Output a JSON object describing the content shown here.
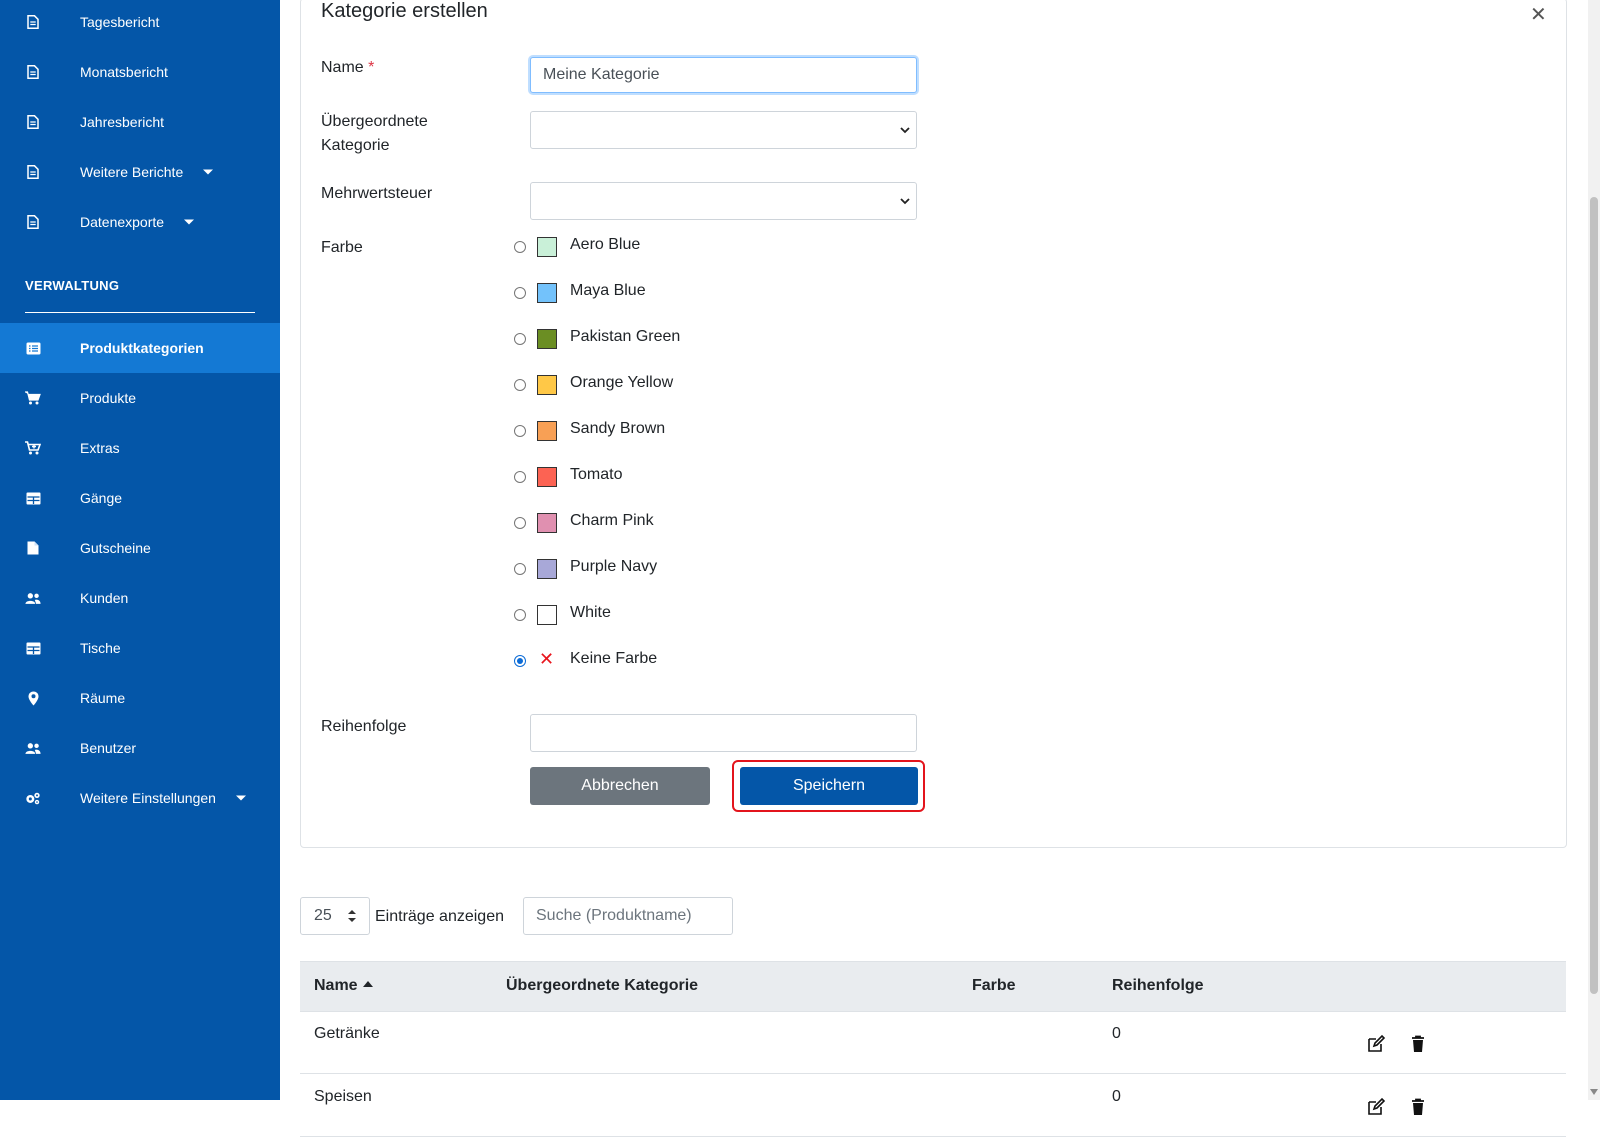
{
  "sidebar": {
    "reports": [
      {
        "label": "Tagesbericht",
        "icon": "document-icon"
      },
      {
        "label": "Monatsbericht",
        "icon": "document-icon"
      },
      {
        "label": "Jahresbericht",
        "icon": "document-icon"
      },
      {
        "label": "Weitere Berichte",
        "icon": "document-icon",
        "dropdown": true
      },
      {
        "label": "Datenexporte",
        "icon": "document-icon",
        "dropdown": true
      }
    ],
    "section_title": "VERWALTUNG",
    "admin": [
      {
        "label": "Produktkategorien",
        "icon": "list-icon",
        "active": true
      },
      {
        "label": "Produkte",
        "icon": "cart-icon"
      },
      {
        "label": "Extras",
        "icon": "cart-plus-icon"
      },
      {
        "label": "Gänge",
        "icon": "table-icon"
      },
      {
        "label": "Gutscheine",
        "icon": "file-icon"
      },
      {
        "label": "Kunden",
        "icon": "users-icon"
      },
      {
        "label": "Tische",
        "icon": "table-icon"
      },
      {
        "label": "Räume",
        "icon": "map-marker-icon"
      },
      {
        "label": "Benutzer",
        "icon": "users-icon"
      },
      {
        "label": "Weitere Einstellungen",
        "icon": "cogs-icon",
        "dropdown": true
      }
    ]
  },
  "form": {
    "title": "Kategorie erstellen",
    "name_label": "Name",
    "required_mark": "*",
    "name_value": "Meine Kategorie",
    "parent_label": "Übergeordnete Kategorie",
    "parent_value": "",
    "vat_label": "Mehrwertsteuer",
    "vat_value": "",
    "color_label": "Farbe",
    "colors": [
      {
        "name": "Aero Blue",
        "hex": "#c9f0d8"
      },
      {
        "name": "Maya Blue",
        "hex": "#73c2fb"
      },
      {
        "name": "Pakistan Green",
        "hex": "#6b8e23"
      },
      {
        "name": "Orange Yellow",
        "hex": "#ffc847"
      },
      {
        "name": "Sandy Brown",
        "hex": "#f8a055"
      },
      {
        "name": "Tomato",
        "hex": "#fc6353"
      },
      {
        "name": "Charm Pink",
        "hex": "#e090b0"
      },
      {
        "name": "Purple Navy",
        "hex": "#a8a8d8"
      },
      {
        "name": "White",
        "hex": "#ffffff"
      },
      {
        "name": "Keine Farbe",
        "hex": "",
        "selected": true
      }
    ],
    "order_label": "Reihenfolge",
    "order_value": "",
    "cancel_label": "Abbrechen",
    "save_label": "Speichern"
  },
  "table_controls": {
    "page_length": "25",
    "page_length_label": "Einträge anzeigen",
    "search_placeholder": "Suche (Produktname)"
  },
  "table": {
    "headers": [
      "Name",
      "Übergeordnete Kategorie",
      "Farbe",
      "Reihenfolge"
    ],
    "rows": [
      {
        "name": "Getränke",
        "parent": "",
        "color": "",
        "order": "0"
      },
      {
        "name": "Speisen",
        "parent": "",
        "color": "",
        "order": "0"
      }
    ]
  }
}
